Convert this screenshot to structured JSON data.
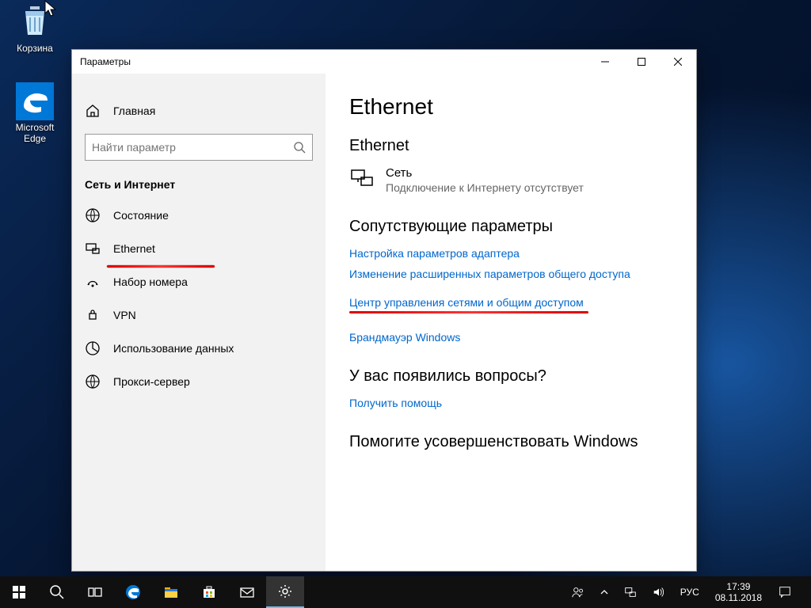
{
  "desktop": {
    "icons": [
      {
        "name": "recycle-bin",
        "label": "Корзина"
      },
      {
        "name": "microsoft-edge",
        "label": "Microsoft Edge"
      }
    ]
  },
  "window": {
    "title": "Параметры"
  },
  "sidebar": {
    "home_label": "Главная",
    "search_placeholder": "Найти параметр",
    "section_label": "Сеть и Интернет",
    "items": [
      {
        "id": "status",
        "label": "Состояние"
      },
      {
        "id": "ethernet",
        "label": "Ethernet",
        "active": true
      },
      {
        "id": "dialup",
        "label": "Набор номера"
      },
      {
        "id": "vpn",
        "label": "VPN"
      },
      {
        "id": "datausage",
        "label": "Использование данных"
      },
      {
        "id": "proxy",
        "label": "Прокси-сервер"
      }
    ]
  },
  "main": {
    "heading": "Ethernet",
    "connection": {
      "section_heading": "Ethernet",
      "name": "Сеть",
      "status": "Подключение к Интернету отсутствует"
    },
    "related": {
      "heading": "Сопутствующие параметры",
      "links": [
        "Настройка параметров адаптера",
        "Изменение расширенных параметров общего доступа",
        "Центр управления сетями и общим доступом",
        "Брандмауэр Windows"
      ]
    },
    "help": {
      "heading": "У вас появились вопросы?",
      "link": "Получить помощь"
    },
    "feedback": {
      "heading": "Помогите усовершенствовать Windows"
    }
  },
  "taskbar": {
    "lang": "РУС",
    "clock": {
      "time": "17:39",
      "date": "08.11.2018"
    }
  }
}
